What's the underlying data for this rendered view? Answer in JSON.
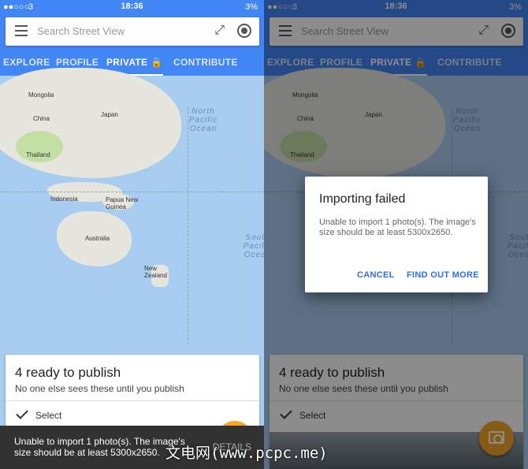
{
  "status_bar": {
    "signal": "●●○○○",
    "carrier": "3",
    "time": "18:36",
    "battery": "3%"
  },
  "search": {
    "placeholder": "Search Street View"
  },
  "tabs": [
    {
      "label": "EXPLORE"
    },
    {
      "label": "PROFILE"
    },
    {
      "label": "PRIVATE"
    },
    {
      "label": "CONTRIBUTE"
    }
  ],
  "map_labels": {
    "mongolia": "Mongolia",
    "china": "China",
    "japan": "Japan",
    "thailand": "Thailand",
    "indonesia": "Indonesia",
    "papua": "Papua New Guinea",
    "australia": "Australia",
    "new_zealand": "New Zealand",
    "north_pacific": "North Pacific Ocean",
    "south_pacific": "South Pacific Ocean"
  },
  "card": {
    "title": "4 ready to publish",
    "subtitle": "No one else sees these until you publish",
    "select_label": "Select"
  },
  "snackbar": {
    "message": "Unable to import 1 photo(s). The image's size should be at least 5300x2650.",
    "action": "DETAILS"
  },
  "dialog": {
    "title": "Importing failed",
    "body": "Unable to import 1 photo(s). The image's size should be at least 5300x2650.",
    "cancel": "CANCEL",
    "find_out_more": "FIND OUT MORE"
  },
  "watermark": "文电网(www.pcpc.me)",
  "colors": {
    "primary": "#4285f4",
    "fab": "#f5a623",
    "dialog_button": "#2f6fe0"
  }
}
